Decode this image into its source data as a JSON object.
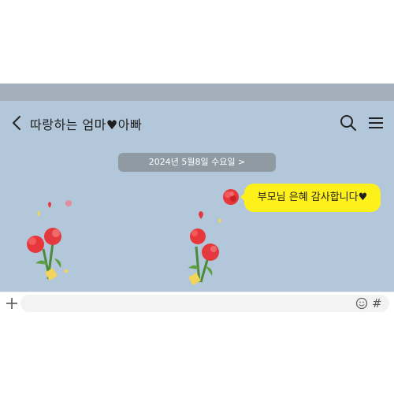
{
  "header": {
    "title": "따랑하는 엄마♥아빠",
    "back_icon": "chevron-left-icon",
    "search_icon": "search-icon",
    "menu_icon": "hamburger-menu-icon"
  },
  "chat": {
    "date_label": "2024년 5월8일 수요일 >",
    "message": "부모님 은혜 감사합니다♥",
    "stickers": [
      "carnation-bouquet-sticker",
      "carnation-sticker",
      "carnation-bouquet-sticker"
    ]
  },
  "input": {
    "plus_icon": "plus-icon",
    "placeholder": "",
    "emoji_icon": "emoticon-icon",
    "hash_label": "#"
  },
  "colors": {
    "chat_background": "#b2c7d9",
    "status_bar": "#a3b0bc",
    "bubble": "#fef01b",
    "date_pill": "#8f9aa3"
  }
}
